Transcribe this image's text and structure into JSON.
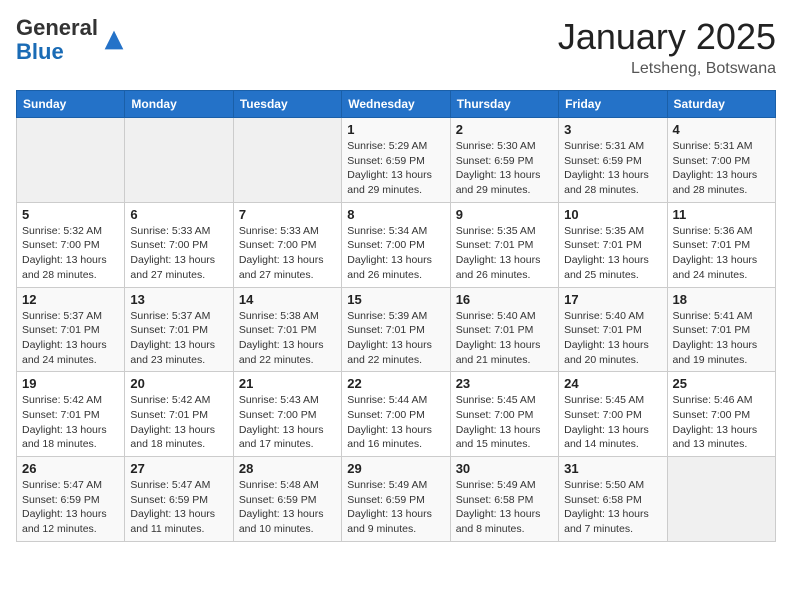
{
  "header": {
    "logo_general": "General",
    "logo_blue": "Blue",
    "month_title": "January 2025",
    "location": "Letsheng, Botswana"
  },
  "weekdays": [
    "Sunday",
    "Monday",
    "Tuesday",
    "Wednesday",
    "Thursday",
    "Friday",
    "Saturday"
  ],
  "weeks": [
    [
      {
        "day": "",
        "info": ""
      },
      {
        "day": "",
        "info": ""
      },
      {
        "day": "",
        "info": ""
      },
      {
        "day": "1",
        "info": "Sunrise: 5:29 AM\nSunset: 6:59 PM\nDaylight: 13 hours\nand 29 minutes."
      },
      {
        "day": "2",
        "info": "Sunrise: 5:30 AM\nSunset: 6:59 PM\nDaylight: 13 hours\nand 29 minutes."
      },
      {
        "day": "3",
        "info": "Sunrise: 5:31 AM\nSunset: 6:59 PM\nDaylight: 13 hours\nand 28 minutes."
      },
      {
        "day": "4",
        "info": "Sunrise: 5:31 AM\nSunset: 7:00 PM\nDaylight: 13 hours\nand 28 minutes."
      }
    ],
    [
      {
        "day": "5",
        "info": "Sunrise: 5:32 AM\nSunset: 7:00 PM\nDaylight: 13 hours\nand 28 minutes."
      },
      {
        "day": "6",
        "info": "Sunrise: 5:33 AM\nSunset: 7:00 PM\nDaylight: 13 hours\nand 27 minutes."
      },
      {
        "day": "7",
        "info": "Sunrise: 5:33 AM\nSunset: 7:00 PM\nDaylight: 13 hours\nand 27 minutes."
      },
      {
        "day": "8",
        "info": "Sunrise: 5:34 AM\nSunset: 7:00 PM\nDaylight: 13 hours\nand 26 minutes."
      },
      {
        "day": "9",
        "info": "Sunrise: 5:35 AM\nSunset: 7:01 PM\nDaylight: 13 hours\nand 26 minutes."
      },
      {
        "day": "10",
        "info": "Sunrise: 5:35 AM\nSunset: 7:01 PM\nDaylight: 13 hours\nand 25 minutes."
      },
      {
        "day": "11",
        "info": "Sunrise: 5:36 AM\nSunset: 7:01 PM\nDaylight: 13 hours\nand 24 minutes."
      }
    ],
    [
      {
        "day": "12",
        "info": "Sunrise: 5:37 AM\nSunset: 7:01 PM\nDaylight: 13 hours\nand 24 minutes."
      },
      {
        "day": "13",
        "info": "Sunrise: 5:37 AM\nSunset: 7:01 PM\nDaylight: 13 hours\nand 23 minutes."
      },
      {
        "day": "14",
        "info": "Sunrise: 5:38 AM\nSunset: 7:01 PM\nDaylight: 13 hours\nand 22 minutes."
      },
      {
        "day": "15",
        "info": "Sunrise: 5:39 AM\nSunset: 7:01 PM\nDaylight: 13 hours\nand 22 minutes."
      },
      {
        "day": "16",
        "info": "Sunrise: 5:40 AM\nSunset: 7:01 PM\nDaylight: 13 hours\nand 21 minutes."
      },
      {
        "day": "17",
        "info": "Sunrise: 5:40 AM\nSunset: 7:01 PM\nDaylight: 13 hours\nand 20 minutes."
      },
      {
        "day": "18",
        "info": "Sunrise: 5:41 AM\nSunset: 7:01 PM\nDaylight: 13 hours\nand 19 minutes."
      }
    ],
    [
      {
        "day": "19",
        "info": "Sunrise: 5:42 AM\nSunset: 7:01 PM\nDaylight: 13 hours\nand 18 minutes."
      },
      {
        "day": "20",
        "info": "Sunrise: 5:42 AM\nSunset: 7:01 PM\nDaylight: 13 hours\nand 18 minutes."
      },
      {
        "day": "21",
        "info": "Sunrise: 5:43 AM\nSunset: 7:00 PM\nDaylight: 13 hours\nand 17 minutes."
      },
      {
        "day": "22",
        "info": "Sunrise: 5:44 AM\nSunset: 7:00 PM\nDaylight: 13 hours\nand 16 minutes."
      },
      {
        "day": "23",
        "info": "Sunrise: 5:45 AM\nSunset: 7:00 PM\nDaylight: 13 hours\nand 15 minutes."
      },
      {
        "day": "24",
        "info": "Sunrise: 5:45 AM\nSunset: 7:00 PM\nDaylight: 13 hours\nand 14 minutes."
      },
      {
        "day": "25",
        "info": "Sunrise: 5:46 AM\nSunset: 7:00 PM\nDaylight: 13 hours\nand 13 minutes."
      }
    ],
    [
      {
        "day": "26",
        "info": "Sunrise: 5:47 AM\nSunset: 6:59 PM\nDaylight: 13 hours\nand 12 minutes."
      },
      {
        "day": "27",
        "info": "Sunrise: 5:47 AM\nSunset: 6:59 PM\nDaylight: 13 hours\nand 11 minutes."
      },
      {
        "day": "28",
        "info": "Sunrise: 5:48 AM\nSunset: 6:59 PM\nDaylight: 13 hours\nand 10 minutes."
      },
      {
        "day": "29",
        "info": "Sunrise: 5:49 AM\nSunset: 6:59 PM\nDaylight: 13 hours\nand 9 minutes."
      },
      {
        "day": "30",
        "info": "Sunrise: 5:49 AM\nSunset: 6:58 PM\nDaylight: 13 hours\nand 8 minutes."
      },
      {
        "day": "31",
        "info": "Sunrise: 5:50 AM\nSunset: 6:58 PM\nDaylight: 13 hours\nand 7 minutes."
      },
      {
        "day": "",
        "info": ""
      }
    ]
  ]
}
